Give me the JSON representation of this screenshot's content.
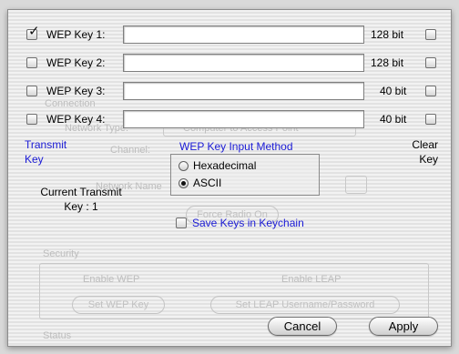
{
  "ghost_background": {
    "items": [
      "Connection",
      "Network Type:",
      "Computer to Access Point",
      "Channel:",
      "Network Name",
      "Security",
      "Enable WEP",
      "Enable LEAP",
      "Set WEP Key",
      "Set LEAP Username/Password",
      "Status",
      "Force Radio On"
    ]
  },
  "wep_keys": [
    {
      "label": "WEP Key 1:",
      "bits": "128 bit",
      "selected": true,
      "value": ""
    },
    {
      "label": "WEP Key 2:",
      "bits": "128 bit",
      "selected": false,
      "value": ""
    },
    {
      "label": "WEP Key 3:",
      "bits": "40 bit",
      "selected": false,
      "value": ""
    },
    {
      "label": "WEP Key 4:",
      "bits": "40 bit",
      "selected": false,
      "value": ""
    }
  ],
  "transmit_key_header_line1": "Transmit",
  "transmit_key_header_line2": "Key",
  "clear_key_header_line1": "Clear",
  "clear_key_header_line2": "Key",
  "input_method": {
    "title": "WEP Key Input Method",
    "options": [
      {
        "label": "Hexadecimal",
        "selected": false
      },
      {
        "label": "ASCII",
        "selected": true
      }
    ]
  },
  "current_transmit": {
    "line1": "Current Transmit",
    "line2": "Key : 1"
  },
  "save_keychain_label": "Save Keys in Keychain",
  "buttons": {
    "cancel": "Cancel",
    "apply": "Apply"
  },
  "colors": {
    "link_blue": "#1b1bd6"
  }
}
